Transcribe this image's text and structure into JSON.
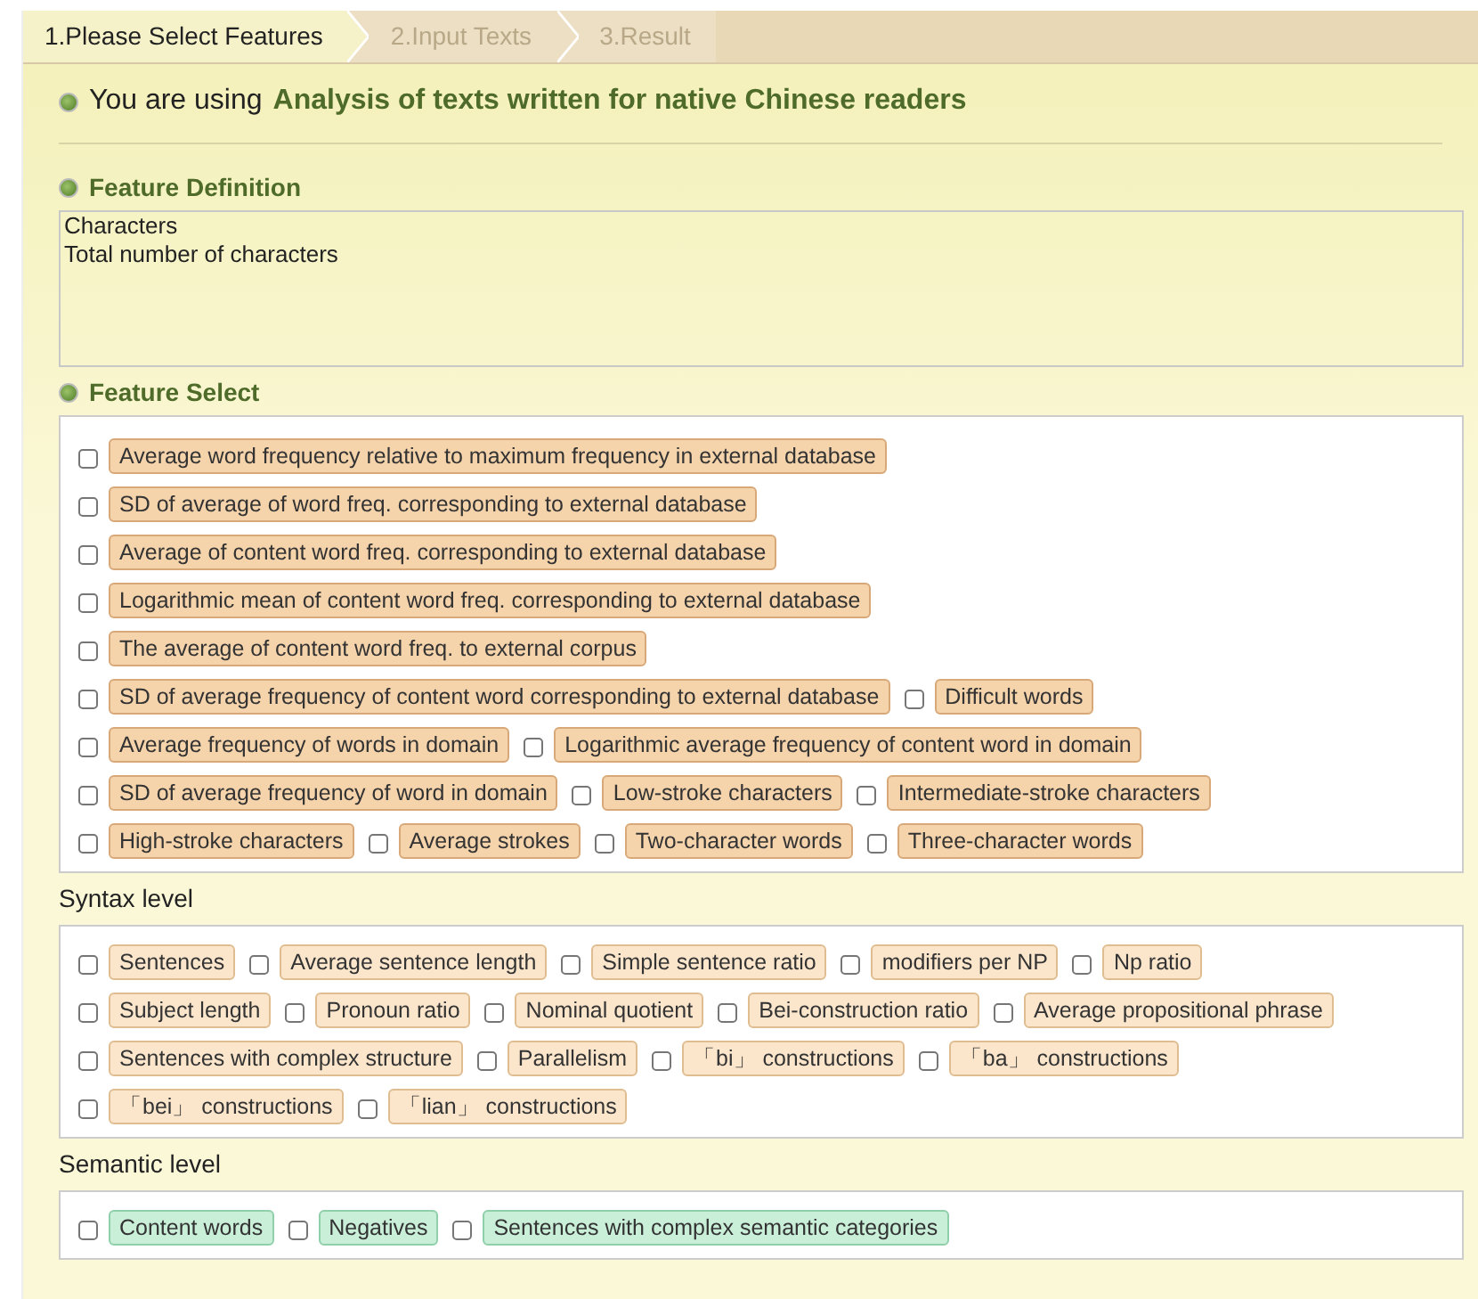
{
  "tabs": [
    {
      "label": "1.Please Select Features",
      "selected": true
    },
    {
      "label": "2.Input Texts",
      "selected": false
    },
    {
      "label": "3.Result",
      "selected": false
    }
  ],
  "intro": {
    "prefix": "You are using",
    "name": "Analysis of texts written for native Chinese readers"
  },
  "definition": {
    "heading": "Feature Definition",
    "lines": [
      "Characters",
      "Total number of characters"
    ]
  },
  "feature_select": {
    "heading": "Feature Select"
  },
  "groups": [
    {
      "kind": "lexical",
      "rows": [
        {
          "items": [
            {
              "label": "Average word frequency relative to maximum frequency in external database",
              "checked": false
            }
          ]
        },
        {
          "items": [
            {
              "label": "SD of average of word freq. corresponding to external database",
              "checked": false
            }
          ]
        },
        {
          "items": [
            {
              "label": "Average of content word freq. corresponding to external database",
              "checked": false
            }
          ]
        },
        {
          "items": [
            {
              "label": "Logarithmic mean of content word freq. corresponding to external database",
              "checked": false
            }
          ]
        },
        {
          "items": [
            {
              "label": "The average of content word freq. to external corpus",
              "checked": false
            }
          ]
        },
        {
          "items": [
            {
              "label": "SD of average frequency of content word corresponding to external database",
              "checked": false
            },
            {
              "label": "Difficult words",
              "checked": false
            }
          ]
        },
        {
          "items": [
            {
              "label": "Average frequency of words in domain",
              "checked": false
            },
            {
              "label": "Logarithmic average frequency of content word in domain",
              "checked": false
            }
          ]
        },
        {
          "items": [
            {
              "label": "SD of average frequency of  word in domain",
              "checked": false
            },
            {
              "label": "Low-stroke characters",
              "checked": false
            },
            {
              "label": "Intermediate-stroke characters",
              "checked": false
            }
          ]
        },
        {
          "items": [
            {
              "label": "High-stroke characters",
              "checked": false
            },
            {
              "label": "Average strokes",
              "checked": false
            },
            {
              "label": "Two-character words",
              "checked": false
            },
            {
              "label": "Three-character words",
              "checked": false
            }
          ]
        }
      ]
    },
    {
      "kind": "syntax",
      "heading": "Syntax level",
      "rows": [
        {
          "items": [
            {
              "label": "Sentences",
              "checked": false
            },
            {
              "label": "Average sentence length",
              "checked": false
            },
            {
              "label": "Simple sentence ratio",
              "checked": false
            },
            {
              "label": "modifiers per NP",
              "checked": false
            },
            {
              "label": "Np ratio",
              "checked": false
            }
          ]
        },
        {
          "items": [
            {
              "label": "Subject length",
              "checked": false
            },
            {
              "label": "Pronoun ratio",
              "checked": false
            },
            {
              "label": "Nominal quotient",
              "checked": false
            },
            {
              "label": "Bei-construction ratio",
              "checked": false
            },
            {
              "label": "Average propositional phrase",
              "checked": false
            }
          ]
        },
        {
          "items": [
            {
              "label": "Sentences with complex structure",
              "checked": false
            },
            {
              "label": "Parallelism",
              "checked": false
            },
            {
              "label": "「bi」 constructions",
              "checked": false
            },
            {
              "label": "「ba」 constructions",
              "checked": false
            }
          ]
        },
        {
          "items": [
            {
              "label": "「bei」 constructions",
              "checked": false
            },
            {
              "label": "「lian」 constructions",
              "checked": false
            }
          ]
        }
      ]
    },
    {
      "kind": "semantic",
      "heading": "Semantic level",
      "rows": [
        {
          "items": [
            {
              "label": "Content words",
              "checked": false
            },
            {
              "label": "Negatives",
              "checked": false
            },
            {
              "label": "Sentences with complex semantic categories",
              "checked": false
            }
          ]
        }
      ]
    }
  ]
}
